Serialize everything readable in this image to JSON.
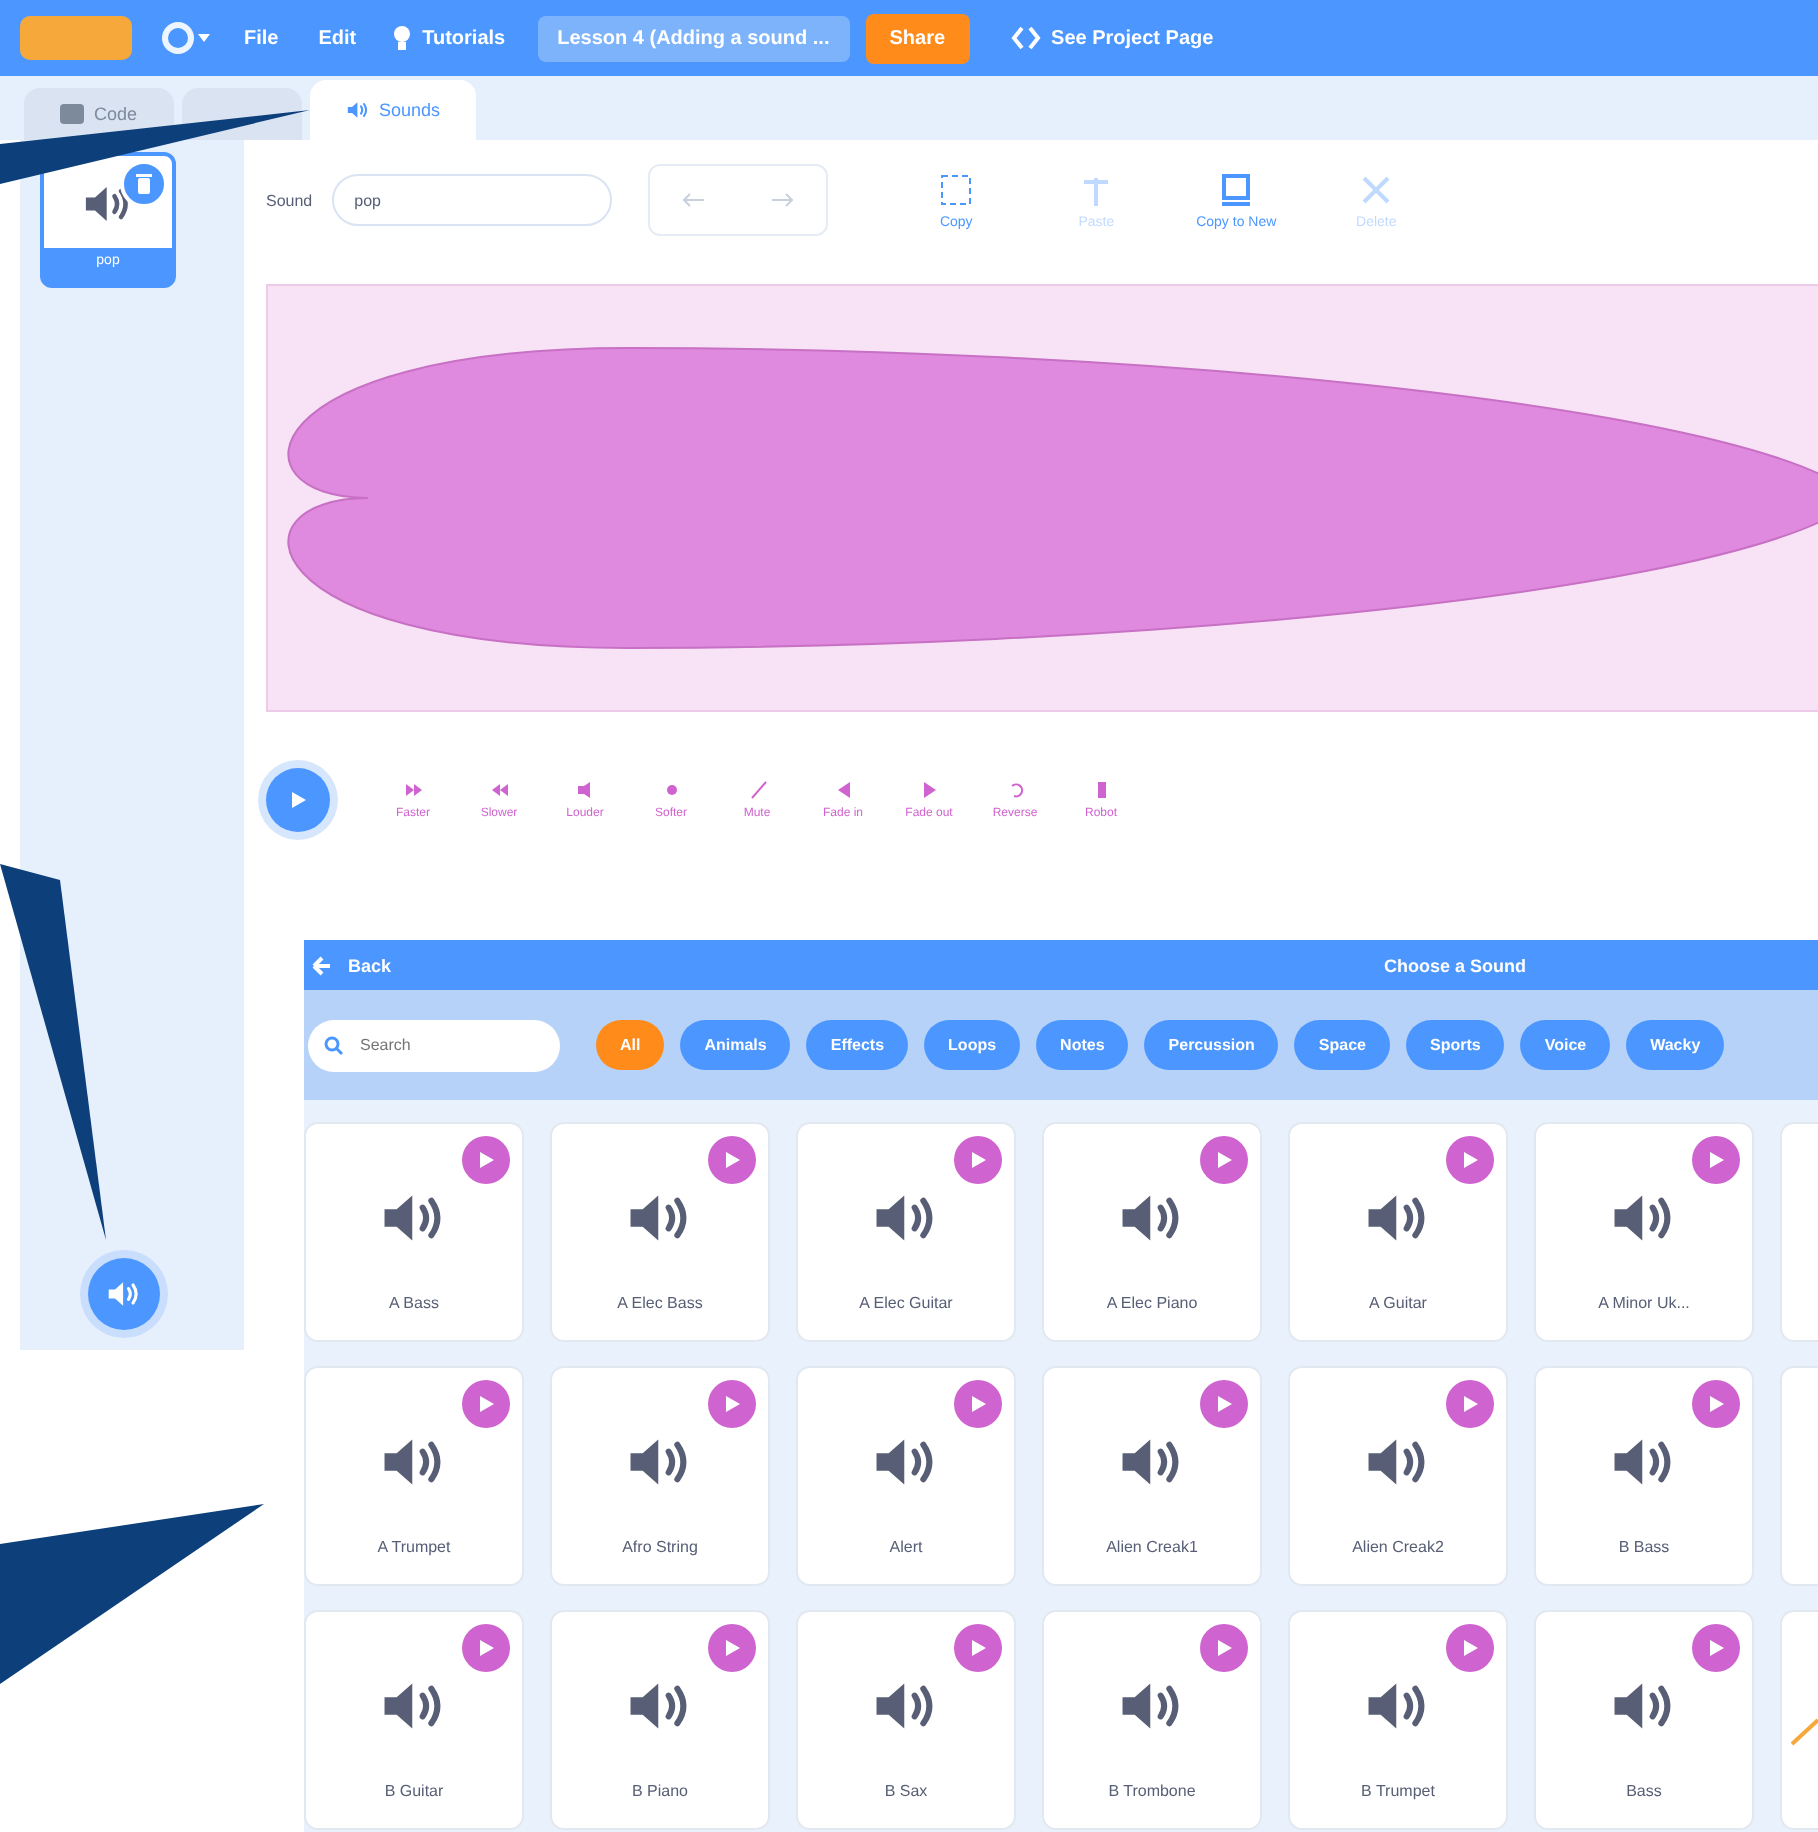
{
  "menu_bar": {
    "items": [
      "File",
      "Edit"
    ],
    "tutorials": "Tutorials",
    "project_title": "Lesson 4 (Adding a sound ...",
    "share": "Share",
    "see_project": "See Project Page"
  },
  "tabs": [
    {
      "label": "Code",
      "selected": false
    },
    {
      "label": "Sounds",
      "selected": true
    }
  ],
  "sound_list": [
    {
      "name": "pop",
      "selected": true
    }
  ],
  "editor": {
    "sound_label": "Sound",
    "sound_name": "pop",
    "tools": [
      {
        "label": "Copy",
        "disabled": false
      },
      {
        "label": "Paste",
        "disabled": true
      },
      {
        "label": "Copy to New",
        "disabled": false
      },
      {
        "label": "Delete",
        "disabled": true
      }
    ],
    "effects": [
      "Faster",
      "Slower",
      "Louder",
      "Softer",
      "Mute",
      "Fade in",
      "Fade out",
      "Reverse",
      "Robot"
    ]
  },
  "library": {
    "back": "Back",
    "title": "Choose a Sound",
    "search_placeholder": "Search",
    "categories": [
      {
        "label": "All",
        "selected": true
      },
      {
        "label": "Animals",
        "selected": false
      },
      {
        "label": "Effects",
        "selected": false
      },
      {
        "label": "Loops",
        "selected": false
      },
      {
        "label": "Notes",
        "selected": false
      },
      {
        "label": "Percussion",
        "selected": false
      },
      {
        "label": "Space",
        "selected": false
      },
      {
        "label": "Sports",
        "selected": false
      },
      {
        "label": "Voice",
        "selected": false
      },
      {
        "label": "Wacky",
        "selected": false
      }
    ],
    "sounds": [
      "A Bass",
      "A Elec Bass",
      "A Elec Guitar",
      "A Elec Piano",
      "A Guitar",
      "A Minor Uk...",
      "A Trumpet",
      "Afro String",
      "Alert",
      "Alien Creak1",
      "Alien Creak2",
      "B Bass",
      "B Guitar",
      "B Piano",
      "B Sax",
      "B Trombone",
      "B Trumpet",
      "Bass"
    ]
  }
}
